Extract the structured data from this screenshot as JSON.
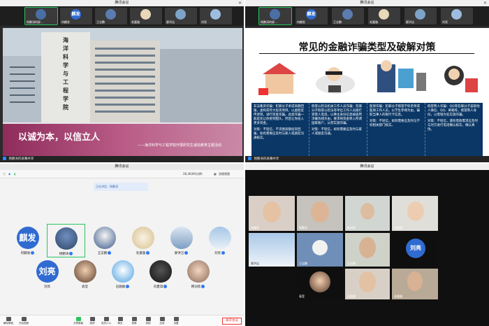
{
  "q1": {
    "window_title": "腾讯会议",
    "participants": [
      {
        "name": "杨鹏涛的屏..."
      },
      {
        "name": "何麒发"
      },
      {
        "name": "王志鹏"
      },
      {
        "name": "毛嘉璇"
      },
      {
        "name": "廖洪洁"
      },
      {
        "name": "刘亮"
      }
    ],
    "slide": {
      "slogan": "以诚为本，以信立人",
      "subtitle": "——海洋科学与工程学院开展研究生诚信教育主题活动"
    },
    "status": "杨鹏涛的屏幕共享"
  },
  "q2": {
    "window_title": "腾讯会议",
    "participants": [
      {
        "name": "杨鹏涛的屏..."
      },
      {
        "name": "何麒发"
      },
      {
        "name": "王志鹏"
      },
      {
        "name": "毛嘉璇"
      },
      {
        "name": "廖洪洁"
      },
      {
        "name": "刘亮"
      }
    ],
    "slide": {
      "heading": "常见的金融诈骗类型及破解对策",
      "columns": [
        {
          "p1": "非法集资诈骗：犯罪分子承诺高额回报，虚构或夸大投资项目，以虚假宣传诱饵，进行资金诈骗。此类诈骗一般是先让你尝到甜头，然后让你投入更多资金。",
          "p2": "对策：不轻信，不贪图高额投资回报，如有需要应及时与家人或朋友沟通核实。"
        },
        {
          "p1": "假冒公检法机关工作人员诈骗：犯罪分子假冒公检法等单位工作人员拨打受害人电话，以事主身份信息被盗用涉嫌洗钱为由，要求将资金转入所谓国家账户，从而实施诈骗。",
          "p2": "对策：不轻信，如有需要应及时与家人或朋友沟通。"
        },
        {
          "p1": "医保诈骗：犯罪分子假冒学校老师或医保工作人员，以学生参保为由，骗取当事人的银行卡信息。",
          "p2": "对策：不轻信，如有需要应及时与学校相关部门核实。"
        },
        {
          "p1": "假冒熟人诈骗：QQ等犯罪分子盗取他人微信、QQ、邮箱等，假冒熟人身份，以借钱为名实施诈骗。",
          "p2": "对策：不轻信，遇有借款需求应及时与对方进行电话确认核实，确认真伪。"
        }
      ]
    },
    "status": "杨鹏涛的屏幕共享"
  },
  "q3": {
    "window_title": "腾讯会议",
    "toolbar": {
      "meeting_id": "28,36(60分钟)",
      "view": "宫格视图"
    },
    "speaking_label": "正在讲话：杨鹏涛",
    "tiles": [
      {
        "name": "何麒发",
        "avatar_text": "麒发"
      },
      {
        "name": "杨鹏涛",
        "avatar_text": ""
      },
      {
        "name": "王志鹏",
        "avatar_text": ""
      },
      {
        "name": "毛嘉璇",
        "avatar_text": ""
      },
      {
        "name": "廖洪洁",
        "avatar_text": ""
      },
      {
        "name": "刘亮",
        "avatar_text": ""
      },
      {
        "name": "刘亮",
        "avatar_text": "刘亮"
      },
      {
        "name": "袁莹",
        "avatar_text": ""
      },
      {
        "name": "石融融",
        "avatar_text": ""
      },
      {
        "name": "刘夏琪",
        "avatar_text": ""
      },
      {
        "name": "韩词欣",
        "avatar_text": ""
      }
    ],
    "bottom_buttons": [
      {
        "label": "解除静音"
      },
      {
        "label": "开启视频"
      },
      {
        "label": "共享屏幕"
      },
      {
        "label": "邀请"
      },
      {
        "label": "成员(11)"
      },
      {
        "label": "聊天"
      },
      {
        "label": "表情"
      },
      {
        "label": "录制"
      },
      {
        "label": "应用"
      },
      {
        "label": "设置"
      }
    ],
    "end_button": "离开会议"
  },
  "q4": {
    "window_title": "腾讯会议",
    "tiles": [
      {
        "name": "何麒发"
      },
      {
        "name": "杨鹏涛"
      },
      {
        "name": "韩词欣"
      },
      {
        "name": "刘夏琪"
      },
      {
        "name": "廖洪洁"
      },
      {
        "name": "王志鹏"
      },
      {
        "name": "刘亮",
        "avatar_text": "刘亮"
      },
      {
        "name": "袁莹"
      },
      {
        "name": "石融融"
      },
      {
        "name": "毛嘉璇"
      }
    ]
  }
}
